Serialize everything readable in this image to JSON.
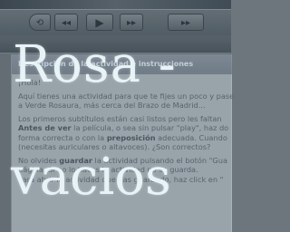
{
  "player": {
    "prev_icon": "⟲",
    "rewind_icon": "◂◂",
    "play_icon": "▶",
    "forward_icon": "▸▸",
    "next_icon": "▸▸"
  },
  "panel": {
    "header": "Descripción de la actividad e instrucciones",
    "greeting": "¡Hola!",
    "intro_line1": "Aquí tienes una actividad para que te fijes un poco y pase",
    "intro_line2": "a Verde Rosaura, más cerca del Brazo de Madrid...",
    "para2_line1": "Los primeros subtítulos están casi listos pero les faltan",
    "para2_bold1": "Antes de ver",
    "para2_line2_rest": " la película, o sea sin pulsar \"play\", haz do",
    "para2_line3_start": "forma correcta o con la ",
    "para2_bold2": "preposición",
    "para2_line3_end": " adecuada.  Cuando",
    "para2_line4": "(necesitas auriculares o altavoces). ¿Son correctos?",
    "para3_line1_start": "No olvides ",
    "para3_bold": "guardar",
    "para3_line1_end": " la actividad pulsando el botón \"Gua",
    "para3_line2": "página. Si no lo haces la actividad no se guarda.",
    "para3_line3": "Para abrir la actividad que has guardado, haz click en \""
  },
  "overlay": {
    "line1": "Rosa -",
    "line2": "vacios"
  }
}
